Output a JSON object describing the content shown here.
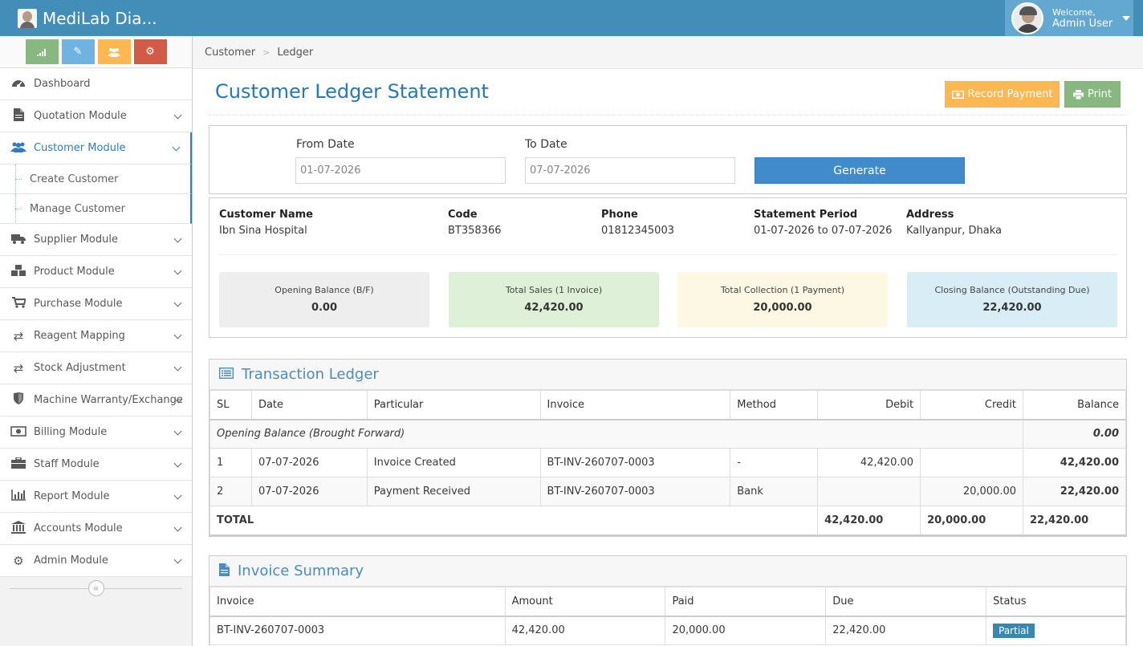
{
  "app": {
    "title": "MediLab Dia...",
    "welcome": "Welcome,",
    "user_name": "Admin User"
  },
  "shortcuts": [
    {
      "icon": "signal-icon",
      "color": "#87b87f"
    },
    {
      "icon": "pencil-icon",
      "color": "#6fb3e0"
    },
    {
      "icon": "users-icon",
      "color": "#ffb752"
    },
    {
      "icon": "cogs-icon",
      "color": "#d15b47"
    }
  ],
  "sidebar": {
    "items": [
      {
        "label": "Dashboard",
        "icon": "tachometer-icon"
      },
      {
        "label": "Quotation Module",
        "icon": "file-icon"
      },
      {
        "label": "Customer Module",
        "icon": "users-icon",
        "active": true
      },
      {
        "label": "Supplier Module",
        "icon": "truck-icon"
      },
      {
        "label": "Product Module",
        "icon": "cubes-icon"
      },
      {
        "label": "Purchase Module",
        "icon": "cart-icon"
      },
      {
        "label": "Reagent Mapping",
        "icon": "exchange-icon"
      },
      {
        "label": "Stock Adjustment",
        "icon": "exchange-icon"
      },
      {
        "label": "Machine Warranty/Exchange",
        "icon": "shield-icon"
      },
      {
        "label": "Billing Module",
        "icon": "money-icon"
      },
      {
        "label": "Staff Module",
        "icon": "briefcase-icon"
      },
      {
        "label": "Report Module",
        "icon": "bar-chart-icon"
      },
      {
        "label": "Accounts Module",
        "icon": "bank-icon"
      },
      {
        "label": "Admin Module",
        "icon": "cog-icon"
      }
    ],
    "sub_items": [
      "Create Customer",
      "Manage Customer"
    ]
  },
  "breadcrumb": [
    "Customer",
    "Ledger"
  ],
  "page": {
    "title": "Customer Ledger Statement",
    "record_payment": "Record Payment",
    "print": "Print"
  },
  "filter": {
    "from_label": "From Date",
    "from_value": "01-07-2026",
    "to_label": "To Date",
    "to_value": "07-07-2026",
    "generate": "Generate"
  },
  "customer": {
    "name_label": "Customer Name",
    "name": "Ibn Sina Hospital",
    "code_label": "Code",
    "code": "BT358366",
    "phone_label": "Phone",
    "phone": "01812345003",
    "period_label": "Statement Period",
    "period": "01-07-2026 to 07-07-2026",
    "address_label": "Address",
    "address": "Kallyanpur, Dhaka"
  },
  "stats": [
    {
      "label": "Opening Balance (B/F)",
      "value": "0.00",
      "color": "#eeeeee"
    },
    {
      "label": "Total Sales (1 Invoice)",
      "value": "42,420.00",
      "color": "#dff0d8"
    },
    {
      "label": "Total Collection (1 Payment)",
      "value": "20,000.00",
      "color": "#fcf8e3"
    },
    {
      "label": "Closing Balance (Outstanding Due)",
      "value": "22,420.00",
      "color": "#d9edf7"
    }
  ],
  "ledger": {
    "title": "Transaction Ledger",
    "headers": [
      "SL",
      "Date",
      "Particular",
      "Invoice",
      "Method",
      "Debit",
      "Credit",
      "Balance"
    ],
    "opening_label": "Opening Balance (Brought Forward)",
    "opening_value": "0.00",
    "rows": [
      {
        "sl": "1",
        "date": "07-07-2026",
        "particular": "Invoice Created",
        "invoice": "BT-INV-260707-0003",
        "method": "-",
        "debit": "42,420.00",
        "credit": "",
        "balance": "42,420.00"
      },
      {
        "sl": "2",
        "date": "07-07-2026",
        "particular": "Payment Received",
        "invoice": "BT-INV-260707-0003",
        "method": "Bank",
        "debit": "",
        "credit": "20,000.00",
        "balance": "22,420.00"
      }
    ],
    "total_label": "TOTAL",
    "total_debit": "42,420.00",
    "total_credit": "20,000.00",
    "total_balance": "22,420.00"
  },
  "invoice_summary": {
    "title": "Invoice Summary",
    "headers": [
      "Invoice",
      "Amount",
      "Paid",
      "Due",
      "Status"
    ],
    "rows": [
      {
        "invoice": "BT-INV-260707-0003",
        "amount": "42,420.00",
        "paid": "20,000.00",
        "due": "22,420.00",
        "status": "Partial"
      }
    ]
  }
}
